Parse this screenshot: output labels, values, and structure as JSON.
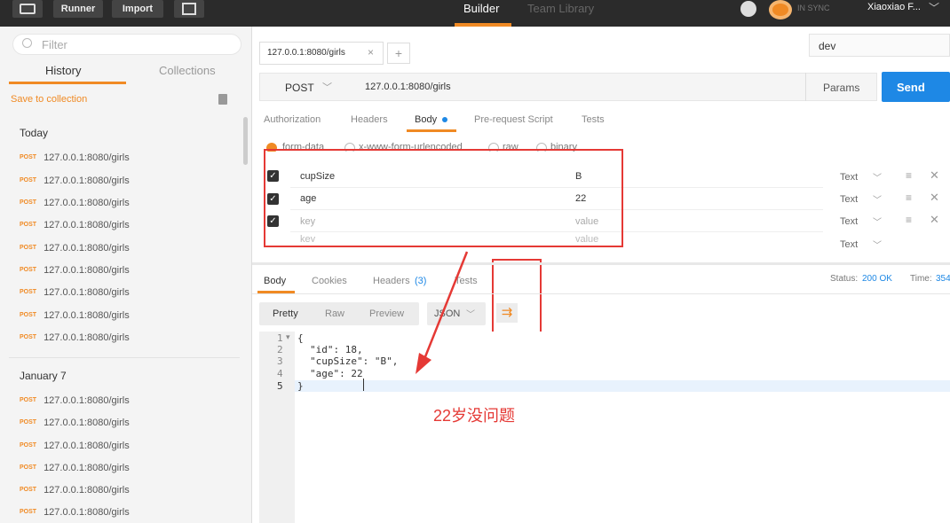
{
  "topbar": {
    "runner": "Runner",
    "import": "Import",
    "builder": "Builder",
    "team_library": "Team Library",
    "sync": "IN SYNC",
    "user": "Xiaoxiao F..."
  },
  "sidebar": {
    "filter_placeholder": "Filter",
    "tab_history": "History",
    "tab_collections": "Collections",
    "save_to_collection": "Save to collection",
    "today": "Today",
    "jan7": "January 7",
    "method": "POST",
    "url": "127.0.0.1:8080/girls"
  },
  "request": {
    "tab_label": "127.0.0.1:8080/girls",
    "env": "dev",
    "method": "POST",
    "url": "127.0.0.1:8080/girls",
    "params": "Params",
    "send": "Send",
    "tabs": [
      "Authorization",
      "Headers",
      "Body",
      "Pre-request Script",
      "Tests"
    ],
    "body_types": [
      "form-data",
      "x-www-form-urlencoded",
      "raw",
      "binary"
    ],
    "rows": [
      {
        "key": "cupSize",
        "value": "B",
        "type": "Text"
      },
      {
        "key": "age",
        "value": "22",
        "type": "Text"
      },
      {
        "key": "key",
        "value": "value",
        "type": "Text"
      },
      {
        "key": "key",
        "value": "value",
        "type": "Text"
      }
    ]
  },
  "response": {
    "tabs": [
      "Body",
      "Cookies",
      "Headers",
      "(3)",
      "Tests"
    ],
    "status_label": "Status:",
    "status_value": "200 OK",
    "time_label": "Time:",
    "time_value": "354",
    "views": [
      "Pretty",
      "Raw",
      "Preview"
    ],
    "format": "JSON",
    "lines": [
      "{",
      "\"id\": 18,",
      "\"cupSize\": \"B\",",
      "\"age\": 22",
      "}"
    ],
    "line_numbers": [
      "1",
      "2",
      "3",
      "4",
      "5"
    ]
  },
  "annotation": {
    "text": "22岁没问题",
    "color": "#e53935"
  }
}
